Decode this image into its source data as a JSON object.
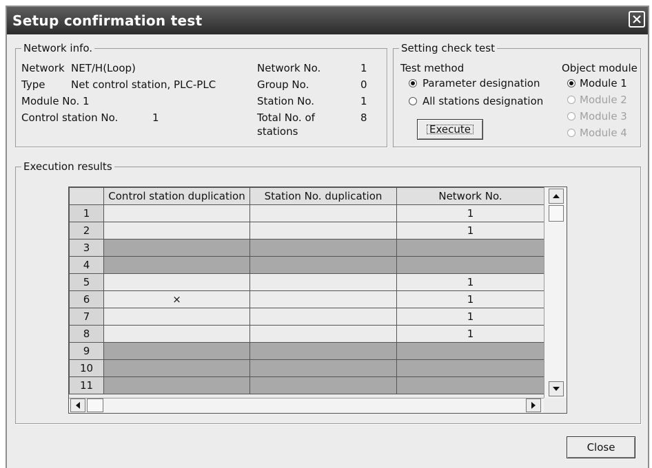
{
  "window": {
    "title": "Setup confirmation test"
  },
  "network_info": {
    "legend": "Network info.",
    "network_label": "Network",
    "network_value": "NET/H(Loop)",
    "type_label": "Type",
    "type_value": "Net control station, PLC-PLC",
    "module_label": "Module No. 1",
    "control_station_label": "Control station No.",
    "control_station_value": "1",
    "network_no_label": "Network No.",
    "network_no_value": "1",
    "group_no_label": "Group No.",
    "group_no_value": "0",
    "station_no_label": "Station No.",
    "station_no_value": "1",
    "total_label_line1": "Total No. of",
    "total_label_line2": "stations",
    "total_value": "8"
  },
  "setting_check": {
    "legend": "Setting check test",
    "test_method_label": "Test method",
    "method_options": [
      {
        "label": "Parameter designation",
        "selected": true
      },
      {
        "label": "All stations designation",
        "selected": false
      }
    ],
    "object_module_label": "Object module",
    "module_options": [
      {
        "label": "Module 1",
        "selected": true,
        "enabled": true
      },
      {
        "label": "Module 2",
        "selected": false,
        "enabled": false
      },
      {
        "label": "Module 3",
        "selected": false,
        "enabled": false
      },
      {
        "label": "Module 4",
        "selected": false,
        "enabled": false
      }
    ],
    "execute_label": "Execute"
  },
  "results": {
    "legend": "Execution results",
    "columns": [
      "Control station duplication",
      "Station No. duplication",
      "Network No."
    ],
    "rows": [
      {
        "no": "1",
        "ctrl": "",
        "station": "",
        "network": "1",
        "shaded": false
      },
      {
        "no": "2",
        "ctrl": "",
        "station": "",
        "network": "1",
        "shaded": false
      },
      {
        "no": "3",
        "ctrl": "",
        "station": "",
        "network": "",
        "shaded": true
      },
      {
        "no": "4",
        "ctrl": "",
        "station": "",
        "network": "",
        "shaded": true
      },
      {
        "no": "5",
        "ctrl": "",
        "station": "",
        "network": "1",
        "shaded": false
      },
      {
        "no": "6",
        "ctrl": "×",
        "station": "",
        "network": "1",
        "shaded": false
      },
      {
        "no": "7",
        "ctrl": "",
        "station": "",
        "network": "1",
        "shaded": false
      },
      {
        "no": "8",
        "ctrl": "",
        "station": "",
        "network": "1",
        "shaded": false
      },
      {
        "no": "9",
        "ctrl": "",
        "station": "",
        "network": "",
        "shaded": true
      },
      {
        "no": "10",
        "ctrl": "",
        "station": "",
        "network": "",
        "shaded": true
      },
      {
        "no": "11",
        "ctrl": "",
        "station": "",
        "network": "",
        "shaded": true
      }
    ]
  },
  "close_label": "Close"
}
